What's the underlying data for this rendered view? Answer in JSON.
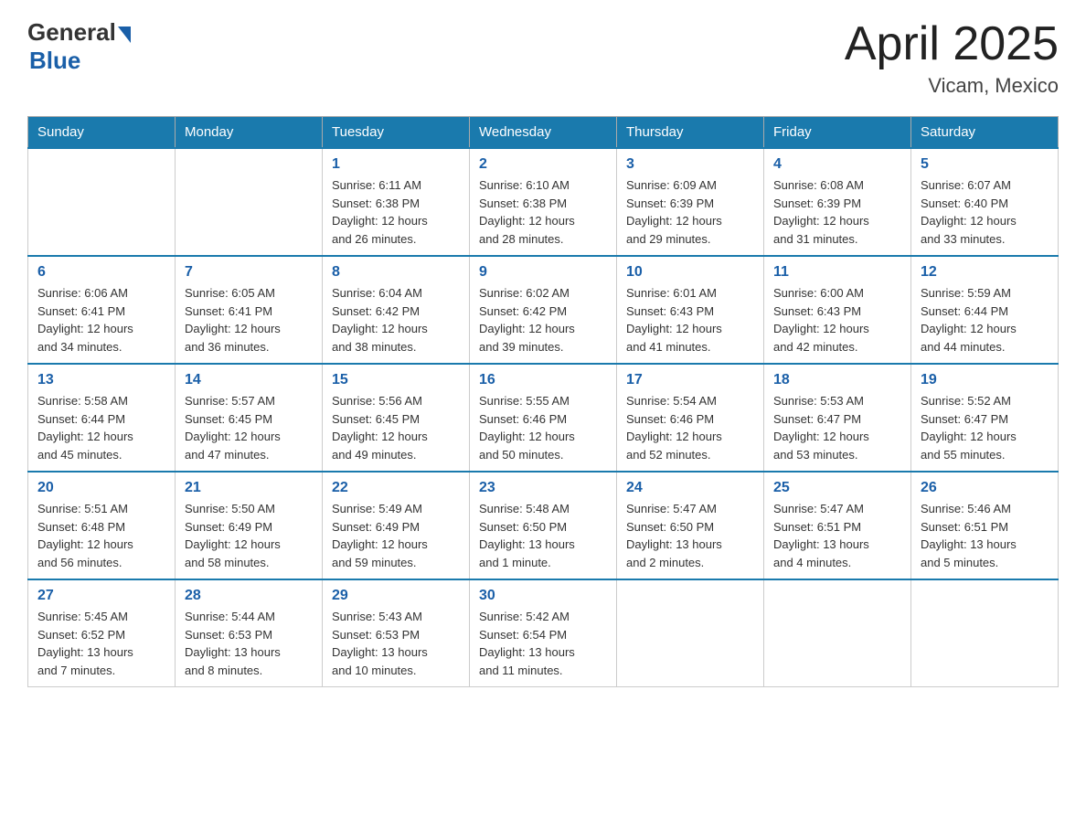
{
  "header": {
    "logo_general": "General",
    "logo_blue": "Blue",
    "title": "April 2025",
    "location": "Vicam, Mexico"
  },
  "calendar": {
    "days_of_week": [
      "Sunday",
      "Monday",
      "Tuesday",
      "Wednesday",
      "Thursday",
      "Friday",
      "Saturday"
    ],
    "weeks": [
      [
        {
          "day": "",
          "info": ""
        },
        {
          "day": "",
          "info": ""
        },
        {
          "day": "1",
          "info": "Sunrise: 6:11 AM\nSunset: 6:38 PM\nDaylight: 12 hours\nand 26 minutes."
        },
        {
          "day": "2",
          "info": "Sunrise: 6:10 AM\nSunset: 6:38 PM\nDaylight: 12 hours\nand 28 minutes."
        },
        {
          "day": "3",
          "info": "Sunrise: 6:09 AM\nSunset: 6:39 PM\nDaylight: 12 hours\nand 29 minutes."
        },
        {
          "day": "4",
          "info": "Sunrise: 6:08 AM\nSunset: 6:39 PM\nDaylight: 12 hours\nand 31 minutes."
        },
        {
          "day": "5",
          "info": "Sunrise: 6:07 AM\nSunset: 6:40 PM\nDaylight: 12 hours\nand 33 minutes."
        }
      ],
      [
        {
          "day": "6",
          "info": "Sunrise: 6:06 AM\nSunset: 6:41 PM\nDaylight: 12 hours\nand 34 minutes."
        },
        {
          "day": "7",
          "info": "Sunrise: 6:05 AM\nSunset: 6:41 PM\nDaylight: 12 hours\nand 36 minutes."
        },
        {
          "day": "8",
          "info": "Sunrise: 6:04 AM\nSunset: 6:42 PM\nDaylight: 12 hours\nand 38 minutes."
        },
        {
          "day": "9",
          "info": "Sunrise: 6:02 AM\nSunset: 6:42 PM\nDaylight: 12 hours\nand 39 minutes."
        },
        {
          "day": "10",
          "info": "Sunrise: 6:01 AM\nSunset: 6:43 PM\nDaylight: 12 hours\nand 41 minutes."
        },
        {
          "day": "11",
          "info": "Sunrise: 6:00 AM\nSunset: 6:43 PM\nDaylight: 12 hours\nand 42 minutes."
        },
        {
          "day": "12",
          "info": "Sunrise: 5:59 AM\nSunset: 6:44 PM\nDaylight: 12 hours\nand 44 minutes."
        }
      ],
      [
        {
          "day": "13",
          "info": "Sunrise: 5:58 AM\nSunset: 6:44 PM\nDaylight: 12 hours\nand 45 minutes."
        },
        {
          "day": "14",
          "info": "Sunrise: 5:57 AM\nSunset: 6:45 PM\nDaylight: 12 hours\nand 47 minutes."
        },
        {
          "day": "15",
          "info": "Sunrise: 5:56 AM\nSunset: 6:45 PM\nDaylight: 12 hours\nand 49 minutes."
        },
        {
          "day": "16",
          "info": "Sunrise: 5:55 AM\nSunset: 6:46 PM\nDaylight: 12 hours\nand 50 minutes."
        },
        {
          "day": "17",
          "info": "Sunrise: 5:54 AM\nSunset: 6:46 PM\nDaylight: 12 hours\nand 52 minutes."
        },
        {
          "day": "18",
          "info": "Sunrise: 5:53 AM\nSunset: 6:47 PM\nDaylight: 12 hours\nand 53 minutes."
        },
        {
          "day": "19",
          "info": "Sunrise: 5:52 AM\nSunset: 6:47 PM\nDaylight: 12 hours\nand 55 minutes."
        }
      ],
      [
        {
          "day": "20",
          "info": "Sunrise: 5:51 AM\nSunset: 6:48 PM\nDaylight: 12 hours\nand 56 minutes."
        },
        {
          "day": "21",
          "info": "Sunrise: 5:50 AM\nSunset: 6:49 PM\nDaylight: 12 hours\nand 58 minutes."
        },
        {
          "day": "22",
          "info": "Sunrise: 5:49 AM\nSunset: 6:49 PM\nDaylight: 12 hours\nand 59 minutes."
        },
        {
          "day": "23",
          "info": "Sunrise: 5:48 AM\nSunset: 6:50 PM\nDaylight: 13 hours\nand 1 minute."
        },
        {
          "day": "24",
          "info": "Sunrise: 5:47 AM\nSunset: 6:50 PM\nDaylight: 13 hours\nand 2 minutes."
        },
        {
          "day": "25",
          "info": "Sunrise: 5:47 AM\nSunset: 6:51 PM\nDaylight: 13 hours\nand 4 minutes."
        },
        {
          "day": "26",
          "info": "Sunrise: 5:46 AM\nSunset: 6:51 PM\nDaylight: 13 hours\nand 5 minutes."
        }
      ],
      [
        {
          "day": "27",
          "info": "Sunrise: 5:45 AM\nSunset: 6:52 PM\nDaylight: 13 hours\nand 7 minutes."
        },
        {
          "day": "28",
          "info": "Sunrise: 5:44 AM\nSunset: 6:53 PM\nDaylight: 13 hours\nand 8 minutes."
        },
        {
          "day": "29",
          "info": "Sunrise: 5:43 AM\nSunset: 6:53 PM\nDaylight: 13 hours\nand 10 minutes."
        },
        {
          "day": "30",
          "info": "Sunrise: 5:42 AM\nSunset: 6:54 PM\nDaylight: 13 hours\nand 11 minutes."
        },
        {
          "day": "",
          "info": ""
        },
        {
          "day": "",
          "info": ""
        },
        {
          "day": "",
          "info": ""
        }
      ]
    ]
  }
}
